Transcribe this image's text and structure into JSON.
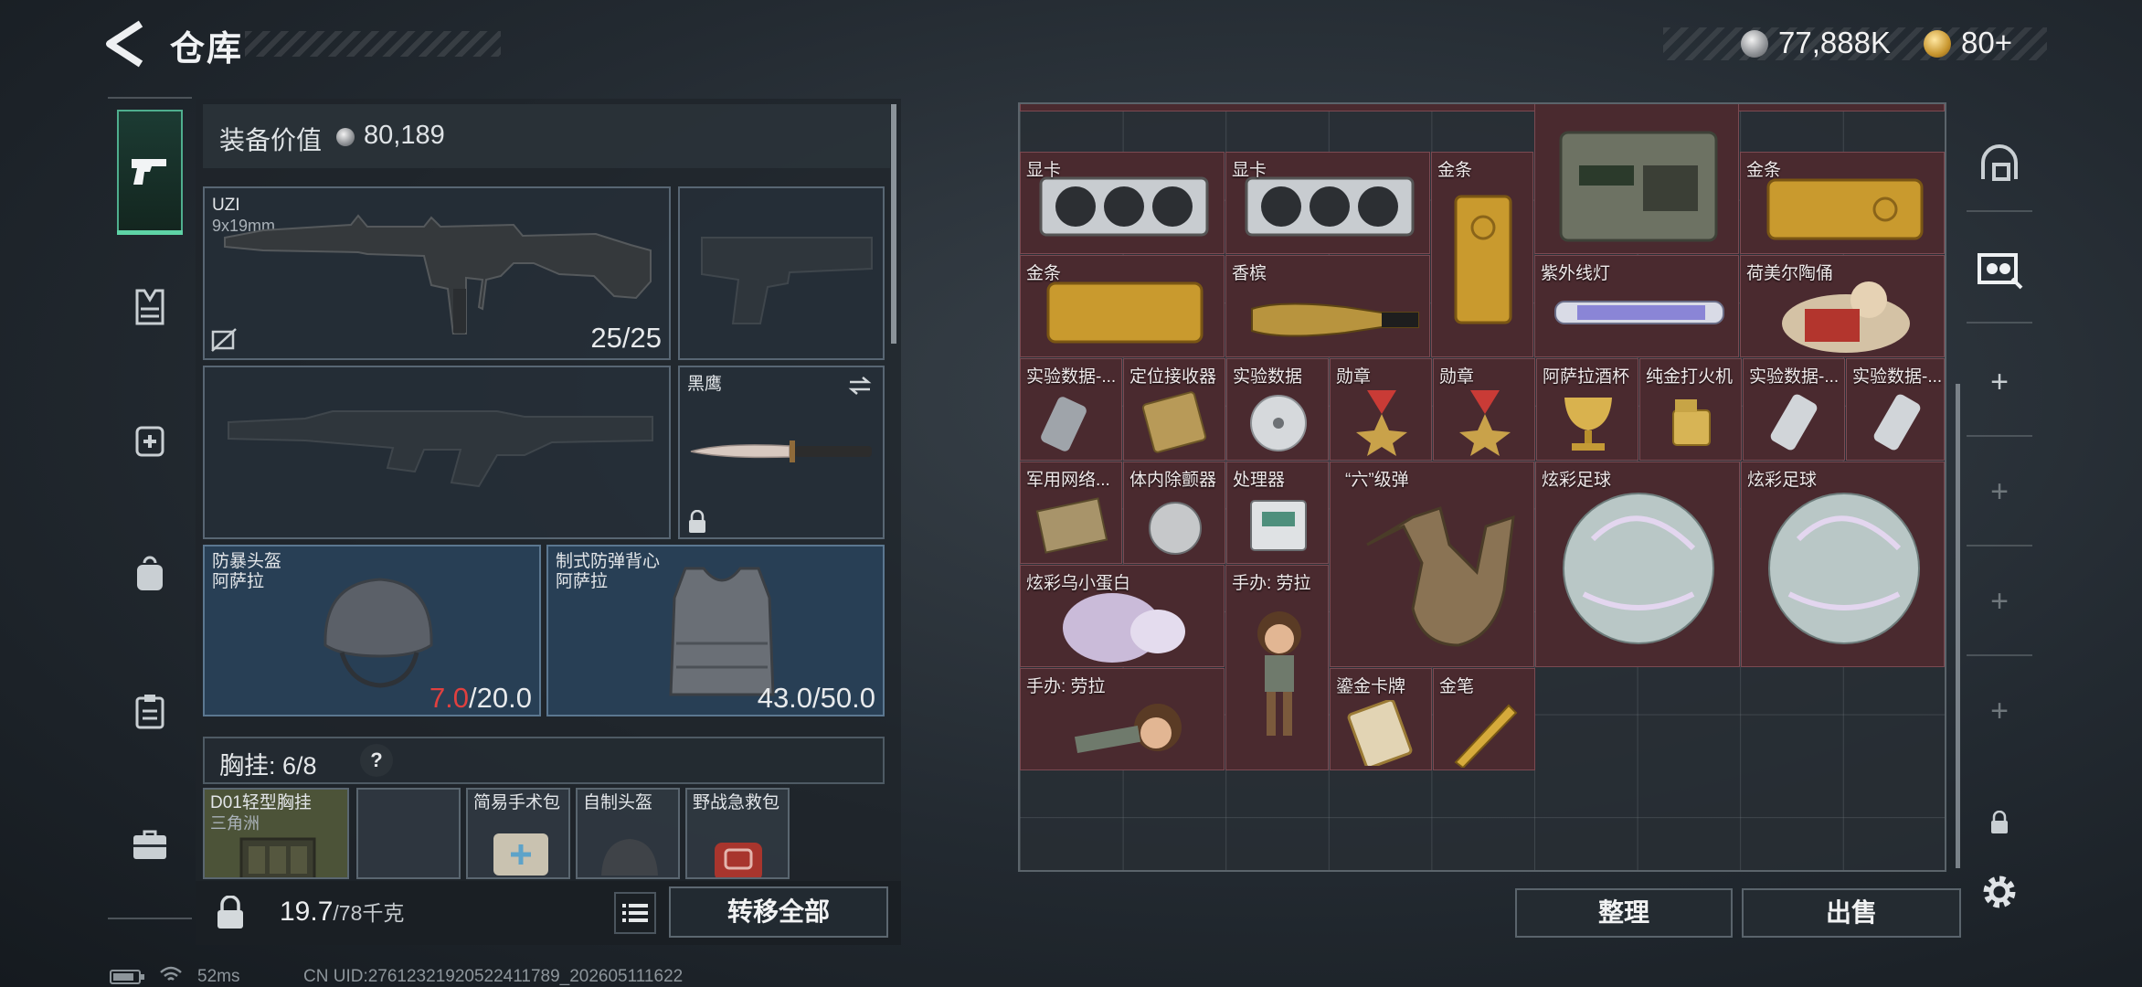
{
  "header": {
    "title": "仓库",
    "silver_amount": "77,888K",
    "gold_amount": "80+"
  },
  "equipment": {
    "value_label": "装备价值",
    "value": "80,189"
  },
  "slots": {
    "primary": {
      "name": "UZI",
      "caliber": "9x19mm",
      "ammo": "25/25"
    },
    "melee": {
      "name": "黑鹰"
    },
    "helmet": {
      "name": "防暴头盔",
      "maker": "阿萨拉",
      "dur_current": "7.0",
      "dur_max": "/20.0"
    },
    "armor": {
      "name": "制式防弹背心",
      "maker": "阿萨拉",
      "durability": "43.0/50.0"
    }
  },
  "chest_rig": {
    "label": "胸挂:",
    "count": "6/8",
    "help": "?",
    "items": [
      {
        "name": "D01轻型胸挂",
        "sub": "三角洲"
      },
      {
        "name": ""
      },
      {
        "name": "简易手术包"
      },
      {
        "name": "自制头盔"
      },
      {
        "name": "野战急救包"
      }
    ]
  },
  "footer_left": {
    "weight": "19.7",
    "capacity": "/78千克",
    "transfer_all": "转移全部"
  },
  "stash": {
    "items": [
      {
        "label": "显卡"
      },
      {
        "label": "显卡"
      },
      {
        "label": "金条"
      },
      {
        "label": ""
      },
      {
        "label": "金条"
      },
      {
        "label": "金条"
      },
      {
        "label": "香槟"
      },
      {
        "label": "紫外线灯"
      },
      {
        "label": "荷美尔陶俑"
      },
      {
        "label": "实验数据-..."
      },
      {
        "label": "定位接收器"
      },
      {
        "label": "实验数据"
      },
      {
        "label": "勋章"
      },
      {
        "label": "勋章"
      },
      {
        "label": "阿萨拉酒杯"
      },
      {
        "label": "纯金打火机"
      },
      {
        "label": "实验数据-..."
      },
      {
        "label": "实验数据-..."
      },
      {
        "label": "军用网络..."
      },
      {
        "label": "体内除颤器"
      },
      {
        "label": "处理器"
      },
      {
        "label": "“六”级弹"
      },
      {
        "label": "炫彩足球"
      },
      {
        "label": "炫彩足球"
      },
      {
        "label": "炫彩乌小蛋白"
      },
      {
        "label": "手办: 劳拉"
      },
      {
        "label": "手办: 劳拉"
      },
      {
        "label": "鎏金卡牌"
      },
      {
        "label": "金笔"
      }
    ],
    "sort": "整理",
    "sell": "出售"
  },
  "status_bar": {
    "ping": "52ms",
    "uid": "CN UID:27612321920522411789_202605111622"
  },
  "colors": {
    "accent": "#5ed3a6",
    "valuable_cell": "#4a2a2f",
    "low_durability": "#e0403f"
  }
}
